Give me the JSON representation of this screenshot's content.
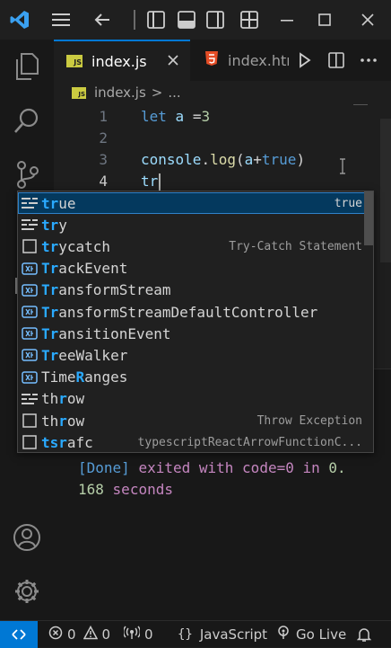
{
  "tabs": [
    {
      "label": "index.js",
      "badge": "JS",
      "active": true
    },
    {
      "label": "index.htm",
      "icon": "html5-icon",
      "active": false
    }
  ],
  "breadcrumb": {
    "file": "index.js",
    "sep": ">",
    "rest": "..."
  },
  "editor": {
    "line_numbers": [
      "1",
      "2",
      "3",
      "4"
    ],
    "current_line": "4",
    "line1": {
      "kw": "let",
      "var": "a",
      "op": " =",
      "num": "3"
    },
    "line3": {
      "obj": "console",
      "dot": ".",
      "fn": "log",
      "open": "(",
      "arg": "a",
      "plus": "+",
      "bool": "true",
      "close": ")"
    },
    "line4": {
      "text": "tr"
    }
  },
  "suggestions": [
    {
      "pre": "",
      "match": "tr",
      "post": "ue",
      "detail": "true",
      "icon": "keyword-icon",
      "selected": true
    },
    {
      "pre": "",
      "match": "tr",
      "post": "y",
      "detail": "",
      "icon": "keyword-icon"
    },
    {
      "pre": "",
      "match": "tr",
      "post": "ycatch",
      "detail": "Try-Catch Statement",
      "icon": "snippet-icon"
    },
    {
      "pre": "",
      "match": "Tr",
      "post": "ackEvent",
      "detail": "",
      "icon": "variable-icon"
    },
    {
      "pre": "",
      "match": "Tr",
      "post": "ansformStream",
      "detail": "",
      "icon": "variable-icon"
    },
    {
      "pre": "",
      "match": "Tr",
      "post": "ansformStreamDefaultController",
      "detail": "",
      "icon": "variable-icon"
    },
    {
      "pre": "",
      "match": "Tr",
      "post": "ansitionEvent",
      "detail": "",
      "icon": "variable-icon"
    },
    {
      "pre": "",
      "match": "Tr",
      "post": "eeWalker",
      "detail": "",
      "icon": "variable-icon"
    },
    {
      "pre": "Time",
      "match": "R",
      "post": "anges",
      "detail": "",
      "icon": "variable-icon"
    },
    {
      "pre": "th",
      "match": "r",
      "post": "ow",
      "detail": "",
      "icon": "keyword-icon"
    },
    {
      "pre": "th",
      "match": "r",
      "post": "ow",
      "detail": "Throw Exception",
      "icon": "snippet-icon"
    },
    {
      "pre": "",
      "match": "tsr",
      "post": "afc",
      "detail": "typescriptReactArrowFunctionC...",
      "icon": "snippet-icon"
    }
  ],
  "terminal": {
    "done": "[Done]",
    "exited": "exited with",
    "code": "code=0",
    "in": "in",
    "value1": "0.",
    "value2": "168",
    "seconds": "seconds"
  },
  "status": {
    "errors": "0",
    "warnings": "0",
    "ports": "0",
    "language": "JavaScript",
    "go_live": "Go Live"
  },
  "colors": {
    "accent": "#0078d4",
    "match": "#2aaaff",
    "selection": "#04395e",
    "js_badge": "#cbcb41",
    "html_icon": "#e44d26"
  }
}
